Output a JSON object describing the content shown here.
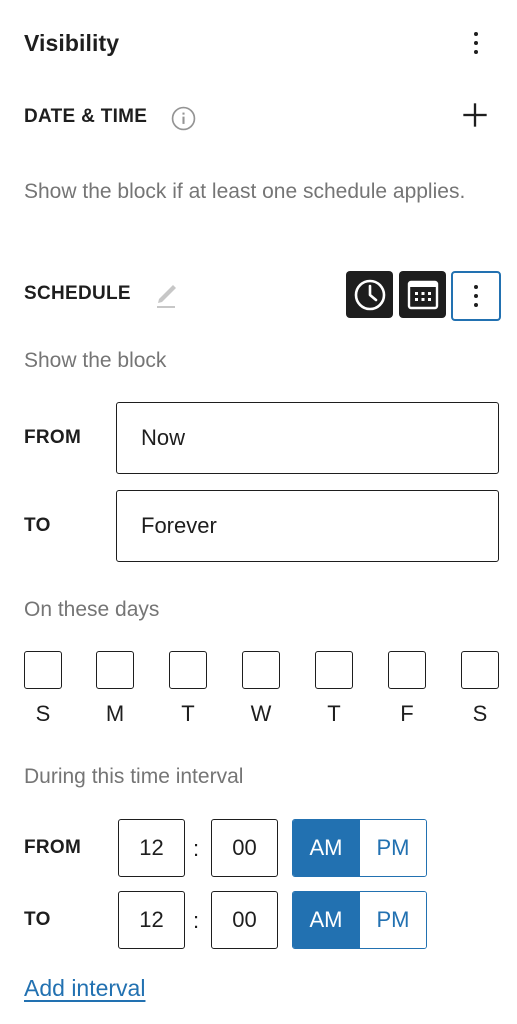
{
  "panel": {
    "title": "Visibility",
    "options_icon": "vertical-ellipsis-icon"
  },
  "section": {
    "title": "DATE & TIME",
    "info_icon": "info-icon",
    "add_icon": "plus-icon",
    "help": "Show the block if at least one schedule applies."
  },
  "schedule": {
    "title": "SCHEDULE",
    "edit_icon": "pencil-icon",
    "buttons": [
      "clock-icon",
      "calendar-icon",
      "vertical-ellipsis-icon"
    ],
    "show_label": "Show the block",
    "from_label": "FROM",
    "from_value": "Now",
    "to_label": "TO",
    "to_value": "Forever"
  },
  "days": {
    "label": "On these days",
    "items": [
      "S",
      "M",
      "T",
      "W",
      "T",
      "F",
      "S"
    ],
    "checked": [
      false,
      false,
      false,
      false,
      false,
      false,
      false
    ]
  },
  "interval": {
    "label": "During this time interval",
    "from": {
      "label": "FROM",
      "hour": "12",
      "minute": "00",
      "am": "AM",
      "pm": "PM",
      "selected": "AM"
    },
    "to": {
      "label": "TO",
      "hour": "12",
      "minute": "00",
      "am": "AM",
      "pm": "PM",
      "selected": "AM"
    },
    "separator": ":",
    "add_label": "Add interval"
  },
  "colors": {
    "accent": "#2271b1",
    "text": "#1e1e1e",
    "muted": "#757575"
  }
}
